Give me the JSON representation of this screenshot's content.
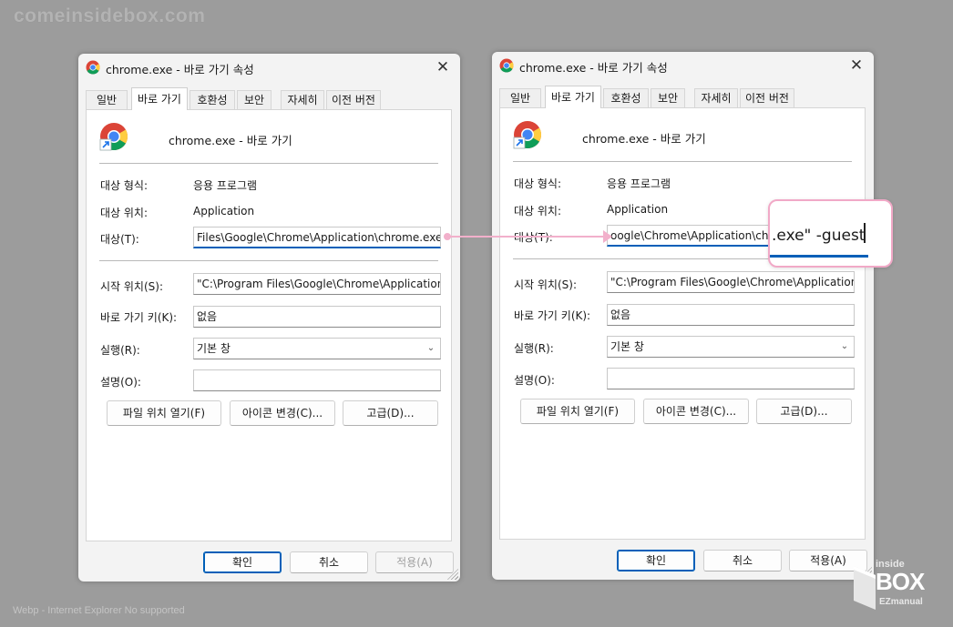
{
  "watermark": "comeinsidebox.com",
  "footnote": "Webp - Internet Explorer No supported",
  "logo": {
    "line1": "inside",
    "line2": "BOX",
    "line3": "EZmanual"
  },
  "dialogs": [
    {
      "title": "chrome.exe - 바로 가기 속성",
      "tabs": [
        "일반",
        "바로 가기",
        "호환성",
        "보안",
        "자세히",
        "이전 버전"
      ],
      "active_tab": "바로 가기",
      "app_name": "chrome.exe - 바로 가기",
      "target_type_label": "대상 형식:",
      "target_type_value": "응용 프로그램",
      "target_location_label": "대상 위치:",
      "target_location_value": "Application",
      "target_label": "대상(T):",
      "target_value": "Files\\Google\\Chrome\\Application\\chrome.exe\"",
      "start_in_label": "시작 위치(S):",
      "start_in_value": "\"C:\\Program Files\\Google\\Chrome\\Application",
      "shortcut_key_label": "바로 가기 키(K):",
      "shortcut_key_value": "없음",
      "run_label": "실행(R):",
      "run_value": "기본 창",
      "comment_label": "설명(O):",
      "comment_value": "",
      "open_location_btn": "파일 위치 열기(F)",
      "change_icon_btn": "아이콘 변경(C)...",
      "advanced_btn": "고급(D)...",
      "ok_btn": "확인",
      "cancel_btn": "취소",
      "apply_btn": "적용(A)"
    },
    {
      "title": "chrome.exe - 바로 가기 속성",
      "tabs": [
        "일반",
        "바로 가기",
        "호환성",
        "보안",
        "자세히",
        "이전 버전"
      ],
      "active_tab": "바로 가기",
      "app_name": "chrome.exe - 바로 가기",
      "target_type_label": "대상 형식:",
      "target_type_value": "응용 프로그램",
      "target_location_label": "대상 위치:",
      "target_location_value": "Application",
      "target_label": "대상(T):",
      "target_value": "oogle\\Chrome\\Application\\chrome.exe\" -guest",
      "start_in_label": "시작 위치(S):",
      "start_in_value": "\"C:\\Program Files\\Google\\Chrome\\Application",
      "shortcut_key_label": "바로 가기 키(K):",
      "shortcut_key_value": "없음",
      "run_label": "실행(R):",
      "run_value": "기본 창",
      "comment_label": "설명(O):",
      "comment_value": "",
      "open_location_btn": "파일 위치 열기(F)",
      "change_icon_btn": "아이콘 변경(C)...",
      "advanced_btn": "고급(D)...",
      "ok_btn": "확인",
      "cancel_btn": "취소",
      "apply_btn": "적용(A)"
    }
  ],
  "zoom": {
    "text": ".exe\" -guest"
  },
  "colors": {
    "accent": "#005fb8",
    "highlight": "#f1a9c7",
    "background": "#9c9c9c"
  }
}
